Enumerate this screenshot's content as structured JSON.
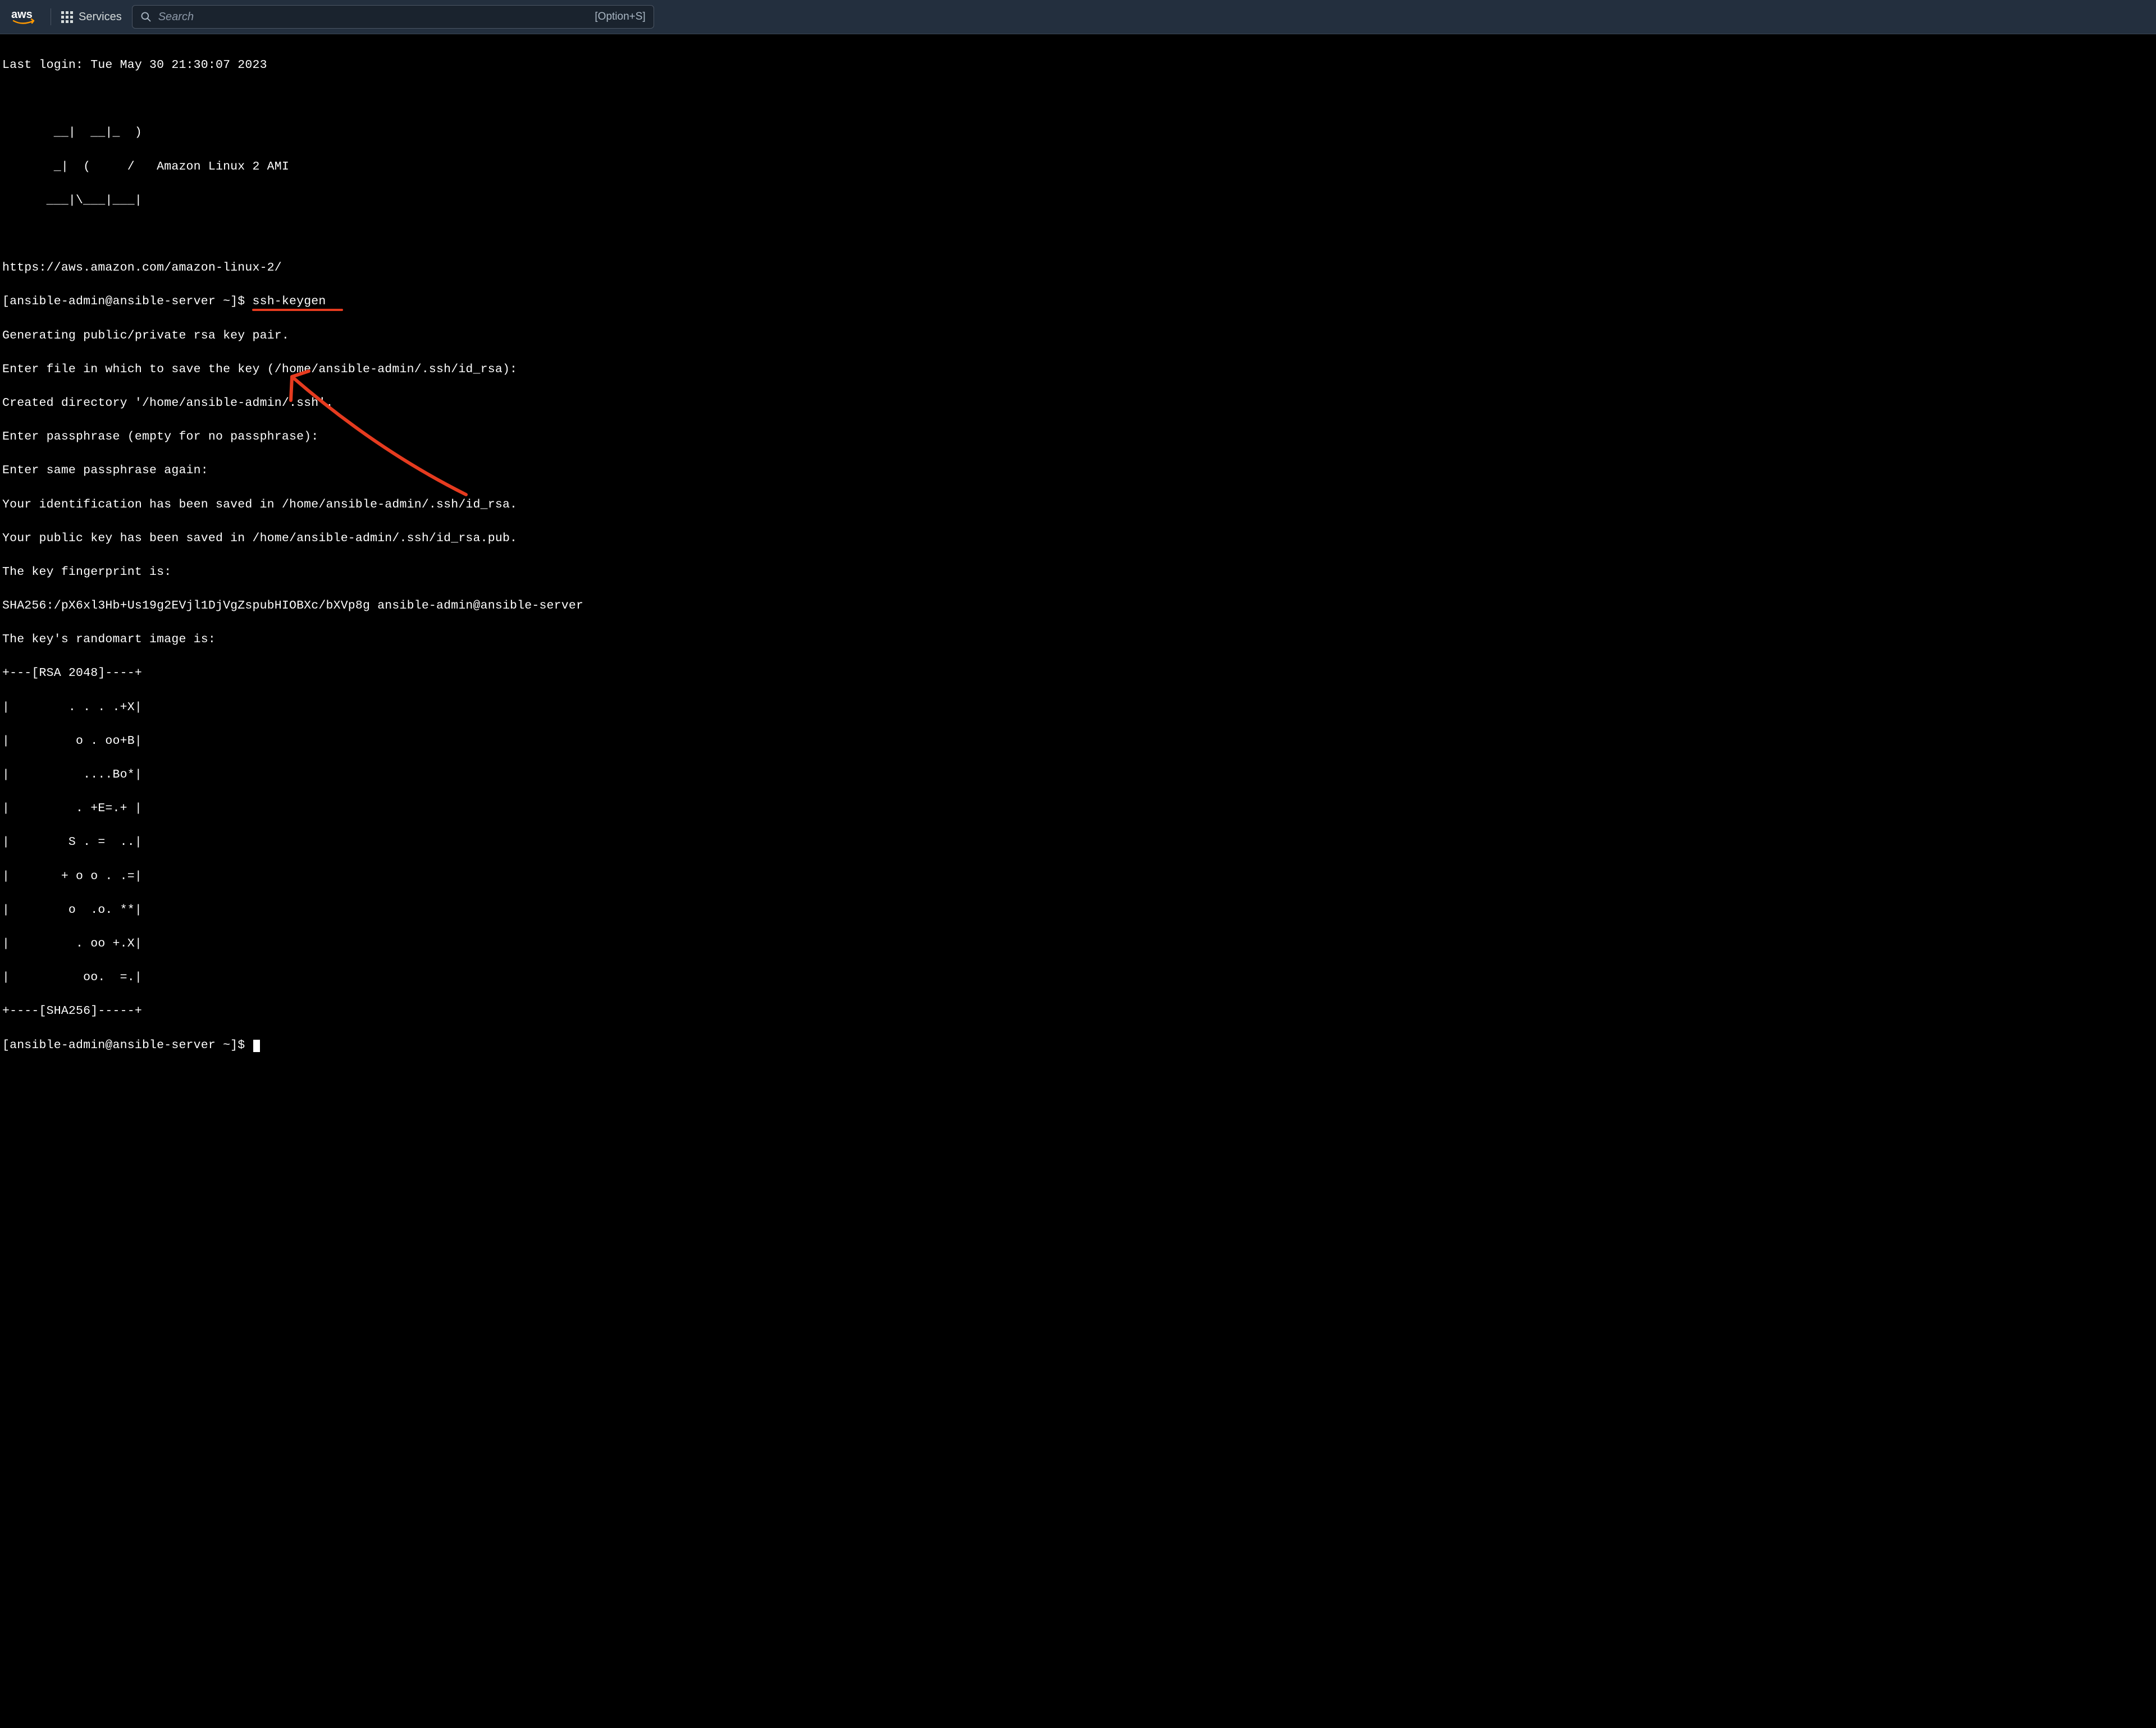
{
  "header": {
    "logo_alt": "aws",
    "services_label": "Services",
    "search_placeholder": "Search",
    "search_hint": "[Option+S]"
  },
  "terminal": {
    "last_login": "Last login: Tue May 30 21:30:07 2023",
    "ascii_art_1": "       __|  __|_  )",
    "ascii_art_2": "       _|  (     /   Amazon Linux 2 AMI",
    "ascii_art_3": "      ___|\\___|___|",
    "url": "https://aws.amazon.com/amazon-linux-2/",
    "prompt1_user": "[ansible-admin@ansible-server ~]$ ",
    "prompt1_cmd": "ssh-keygen",
    "gen_line": "Generating public/private rsa key pair.",
    "enter_file": "Enter file in which to save the key (/home/ansible-admin/.ssh/id_rsa):",
    "created_dir": "Created directory '/home/ansible-admin/.ssh'.",
    "enter_pass": "Enter passphrase (empty for no passphrase):",
    "enter_pass2": "Enter same passphrase again:",
    "id_saved": "Your identification has been saved in /home/ansible-admin/.ssh/id_rsa.",
    "pub_saved": "Your public key has been saved in /home/ansible-admin/.ssh/id_rsa.pub.",
    "fp_label": "The key fingerprint is:",
    "fp_value": "SHA256:/pX6xl3Hb+Us19g2EVjl1DjVgZspubHIOBXc/bXVp8g ansible-admin@ansible-server",
    "randomart_label": "The key's randomart image is:",
    "ra_top": "+---[RSA 2048]----+",
    "ra_1": "|        . . . .+X|",
    "ra_2": "|         o . oo+B|",
    "ra_3": "|          ....Bo*|",
    "ra_4": "|         . +E=.+ |",
    "ra_5": "|        S . =  ..|",
    "ra_6": "|       + o o . .=|",
    "ra_7": "|        o  .o. **|",
    "ra_8": "|         . oo +.X|",
    "ra_9": "|          oo.  =.|",
    "ra_bottom": "+----[SHA256]-----+",
    "prompt2": "[ansible-admin@ansible-server ~]$ "
  },
  "annotations": {
    "underline_target": "ssh-keygen",
    "arrow_color": "#e63b1f"
  }
}
